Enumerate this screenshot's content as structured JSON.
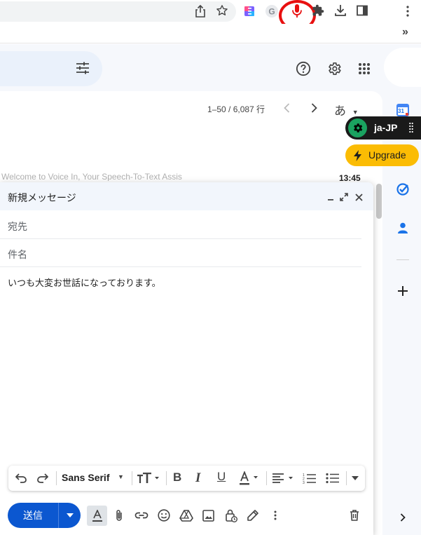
{
  "colors": {
    "accent": "#0b57d0",
    "recording": "#e81010",
    "upgrade": "#fbbc04",
    "extension_bg": "#1a1a1a",
    "extension_gear": "#1aa260"
  },
  "browser": {
    "toolbar_icons": [
      "share-icon",
      "star-icon",
      "extension-icon-1",
      "grammarly-icon",
      "microphone-icon",
      "puzzle-icon",
      "download-icon",
      "side-panel-icon",
      "menu-icon"
    ],
    "bookmarks_overflow": "»"
  },
  "gmail": {
    "header_icons": [
      "search-options-icon",
      "help-icon",
      "settings-icon",
      "apps-icon"
    ],
    "pagination": {
      "range": "1–50 / 6,087 行",
      "input_tool": "あ"
    },
    "email_row": {
      "preview": "Welcome to Voice In, Your Speech-To-Text Assis",
      "time": "13:45"
    },
    "side_panel_icons": [
      "calendar-icon",
      "tasks-icon",
      "contacts-icon",
      "add-icon",
      "expand-icon"
    ],
    "calendar_day": "31"
  },
  "extension": {
    "language": "ja-JP",
    "upgrade_label": "Upgrade"
  },
  "compose": {
    "title": "新規メッセージ",
    "to_placeholder": "宛先",
    "subject_placeholder": "件名",
    "body": "いつも大変お世話になっております。",
    "send_label": "送信",
    "font_name": "Sans Serif",
    "toolbar_icons": [
      "undo-icon",
      "redo-icon",
      "text-size-icon",
      "bold-icon",
      "italic-icon",
      "underline-icon",
      "text-color-icon",
      "align-icon",
      "numbered-list-icon",
      "bulleted-list-icon",
      "more-formatting-icon"
    ],
    "bottom_icons": [
      "formatting-icon",
      "attach-icon",
      "link-icon",
      "emoji-icon",
      "drive-icon",
      "photo-icon",
      "confidential-icon",
      "signature-icon",
      "more-options-icon",
      "discard-icon"
    ]
  }
}
